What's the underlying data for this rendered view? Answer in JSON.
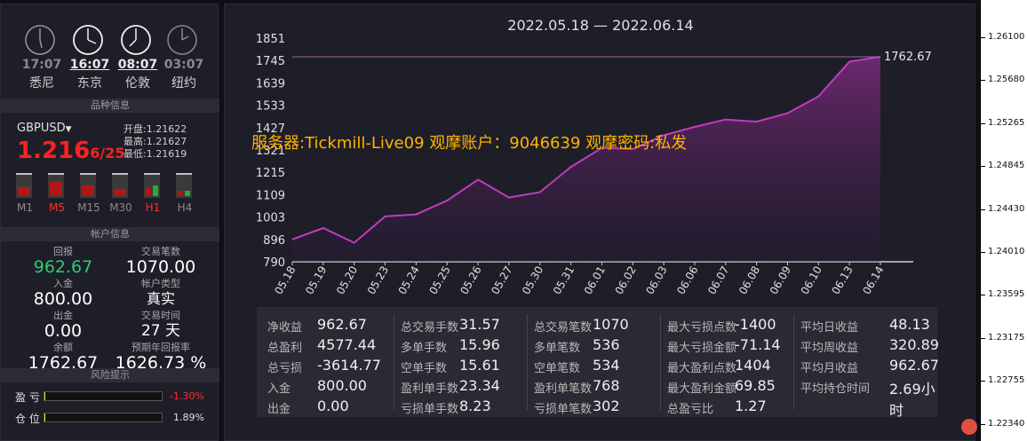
{
  "clocks": [
    {
      "time": "17:07",
      "city": "悉尼",
      "active": false
    },
    {
      "time": "16:07",
      "city": "东京",
      "active": true
    },
    {
      "time": "08:07",
      "city": "伦敦",
      "active": true
    },
    {
      "time": "03:07",
      "city": "纽约",
      "active": false
    }
  ],
  "sections": {
    "variety": "品种信息",
    "account": "帐户信息",
    "risk": "风险提示"
  },
  "symbol": {
    "name": "GBPUSD",
    "bid_big": "1.216",
    "bid_small": "6/25",
    "open_label": "开盘:",
    "open": "1.21622",
    "high_label": "最高:",
    "high": "1.21627",
    "low_label": "最低:",
    "low": "1.21619"
  },
  "timeframes": [
    {
      "label": "M1",
      "red": false
    },
    {
      "label": "M5",
      "red": true
    },
    {
      "label": "M15",
      "red": false
    },
    {
      "label": "M30",
      "red": false
    },
    {
      "label": "H1",
      "red": true
    },
    {
      "label": "H4",
      "red": false
    }
  ],
  "account": {
    "return_label": "回报",
    "return_value": "962.67",
    "trades_label": "交易笔数",
    "trades_value": "1070.00",
    "deposit_label": "入金",
    "deposit_value": "800.00",
    "acc_type_label": "帐户类型",
    "acc_type_value": "真实",
    "withdraw_label": "出金",
    "withdraw_value": "0.00",
    "trade_time_label": "交易时间",
    "trade_time_value": "27 天",
    "balance_label": "余额",
    "balance_value": "1762.67",
    "annual_label": "预期年回报率",
    "annual_value": "1626.73 %"
  },
  "risk": {
    "pl_label": "盈  亏",
    "pl_value": "-1.30%",
    "pl_fill": 0.013,
    "pos_label": "仓  位",
    "pos_value": "1.89%",
    "pos_fill": 0.0189
  },
  "watermark": "服务器:Tickmill-Live09 观摩账户：9046639    观摩密码:私发",
  "chart_data": {
    "type": "area",
    "title": "2022.05.18 — 2022.06.14",
    "categories": [
      "05.18",
      "05.19",
      "05.20",
      "05.23",
      "05.24",
      "05.25",
      "05.26",
      "05.27",
      "05.30",
      "05.31",
      "06.01",
      "06.02",
      "06.03",
      "06.06",
      "06.07",
      "06.08",
      "06.09",
      "06.10",
      "06.13",
      "06.14"
    ],
    "values": [
      896,
      950,
      880,
      1005,
      1015,
      1080,
      1180,
      1095,
      1120,
      1240,
      1330,
      1325,
      1390,
      1430,
      1465,
      1455,
      1495,
      1575,
      1740,
      1762.67
    ],
    "yticks": [
      "1851",
      "1745",
      "1639",
      "1533",
      "1427",
      "1321",
      "1215",
      "1109",
      "1003",
      "896",
      "790"
    ],
    "ylim": [
      790,
      1851
    ],
    "last_label": "1762.67",
    "color": "#c03cc0"
  },
  "stats": [
    [
      {
        "label": "净收益",
        "value": "962.67"
      },
      {
        "label": "总盈利",
        "value": "4577.44"
      },
      {
        "label": "总亏损",
        "value": "-3614.77"
      },
      {
        "label": "入金",
        "value": "800.00"
      },
      {
        "label": "出金",
        "value": "0.00"
      }
    ],
    [
      {
        "label": "总交易手数",
        "value": "31.57"
      },
      {
        "label": "多单手数",
        "value": "15.96"
      },
      {
        "label": "空单手数",
        "value": "15.61"
      },
      {
        "label": "盈利单手数",
        "value": "23.34"
      },
      {
        "label": "亏损单手数",
        "value": "8.23"
      }
    ],
    [
      {
        "label": "总交易笔数",
        "value": "1070"
      },
      {
        "label": "多单笔数",
        "value": "536"
      },
      {
        "label": "空单笔数",
        "value": "534"
      },
      {
        "label": "盈利单笔数",
        "value": "768"
      },
      {
        "label": "亏损单笔数",
        "value": "302"
      }
    ],
    [
      {
        "label": "最大亏损点数",
        "value": "-1400"
      },
      {
        "label": "最大亏损金额",
        "value": "-71.14"
      },
      {
        "label": "最大盈利点数",
        "value": "1404"
      },
      {
        "label": "最大盈利金额",
        "value": "69.85"
      },
      {
        "label": "总盈亏比",
        "value": "1.27"
      }
    ],
    [
      {
        "label": "平均日收益",
        "value": "48.13"
      },
      {
        "label": "平均周收益",
        "value": "320.89"
      },
      {
        "label": "平均月收益",
        "value": "962.67"
      },
      {
        "label": "平均持仓时间",
        "value": "2.69小时"
      },
      {
        "label": "",
        "value": ""
      }
    ]
  ],
  "price_axis": [
    "1.26100",
    "1.25680",
    "1.25265",
    "1.24845",
    "1.24430",
    "1.24010",
    "1.23595",
    "1.23175",
    "1.22755",
    "1.22340"
  ]
}
